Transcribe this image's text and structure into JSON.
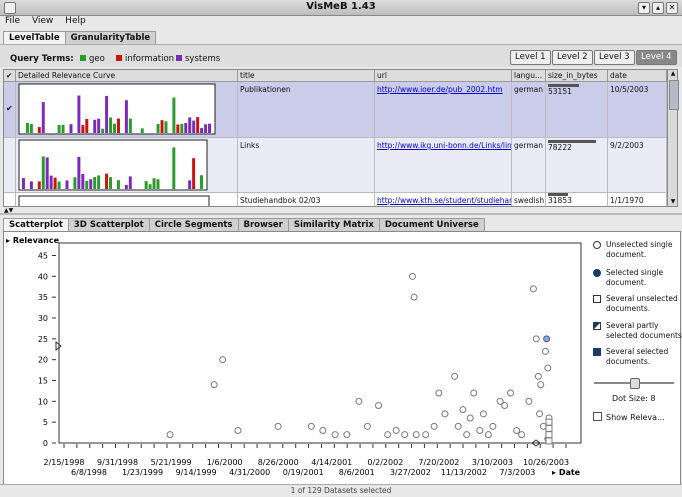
{
  "window": {
    "title": "VisMeB 1.43"
  },
  "menu": [
    "File",
    "View",
    "Help"
  ],
  "top_tabs": [
    "LevelTable",
    "GranularityTable"
  ],
  "query": {
    "label": "Query Terms:",
    "terms": [
      {
        "name": "geo",
        "color": "#2a9a2a"
      },
      {
        "name": "information",
        "color": "#cc1111"
      },
      {
        "name": "systems",
        "color": "#7a2ab8"
      }
    ]
  },
  "levels": [
    "Level 1",
    "Level 2",
    "Level 3",
    "Level 4"
  ],
  "active_level": "Level 4",
  "table": {
    "columns": [
      "Detailed Relevance Curve",
      "title",
      "url",
      "langu...",
      "size_in_bytes",
      "date"
    ],
    "rows": [
      {
        "title": "Publikationen",
        "url": "http://www.ioer.de/pub_2002.htm",
        "lang": "german",
        "size": "53151",
        "size_fraction": 0.55,
        "date": "10/5/2003"
      },
      {
        "title": "Links",
        "url": "http://www.ikg.uni-bonn.de/Links/lin",
        "lang": "german",
        "size": "78222",
        "size_fraction": 0.85,
        "date": "9/2/2003"
      },
      {
        "title": "Studiehandbok 02/03",
        "url": "http://www.kth.se/student/studiehand",
        "lang": "swedish",
        "size": "31853",
        "size_fraction": 0.35,
        "date": "1/1/1970"
      }
    ]
  },
  "bottom_tabs": [
    "Scatterplot",
    "3D Scatterplot",
    "Circle Segments",
    "Browser",
    "Similarity Matrix",
    "Document Universe"
  ],
  "chart_data": {
    "type": "scatter",
    "ylabel": "Relevance",
    "xlabel": "Date",
    "y_ticks": [
      "0",
      "5",
      "10",
      "15",
      "20",
      "25",
      "30",
      "35",
      "40",
      "45"
    ],
    "x_ticks_top": [
      "2/15/1998",
      "9/31/1998",
      "5/21/1999",
      "1/6/2000",
      "8/26/2000",
      "4/14/2001",
      "0/2/2002",
      "7/20/2002",
      "3/10/2003",
      "10/26/2003"
    ],
    "x_ticks_bottom": [
      "6/8/1998",
      "1/23/1999",
      "9/14/1999",
      "4/31/2000",
      "0/19/2001",
      "8/6/2001",
      "3/27/2002",
      "11/13/2002",
      "7/3/2003"
    ],
    "ylim": [
      0,
      48
    ],
    "points": [
      {
        "x": "1999-06-01",
        "y": 2
      },
      {
        "x": "1999-12-05",
        "y": 14
      },
      {
        "x": "2000-01-10",
        "y": 20
      },
      {
        "x": "2000-03-15",
        "y": 3
      },
      {
        "x": "2000-09-01",
        "y": 4
      },
      {
        "x": "2001-01-20",
        "y": 4
      },
      {
        "x": "2001-03-10",
        "y": 3
      },
      {
        "x": "2001-05-01",
        "y": 2
      },
      {
        "x": "2001-06-20",
        "y": 2
      },
      {
        "x": "2001-08-10",
        "y": 10
      },
      {
        "x": "2001-09-15",
        "y": 4
      },
      {
        "x": "2001-11-01",
        "y": 9
      },
      {
        "x": "2001-12-10",
        "y": 2
      },
      {
        "x": "2002-01-15",
        "y": 3
      },
      {
        "x": "2002-02-20",
        "y": 2
      },
      {
        "x": "2002-03-25",
        "y": 40
      },
      {
        "x": "2002-04-01",
        "y": 35
      },
      {
        "x": "2002-04-10",
        "y": 2
      },
      {
        "x": "2002-05-20",
        "y": 2
      },
      {
        "x": "2002-06-25",
        "y": 4
      },
      {
        "x": "2002-07-15",
        "y": 12
      },
      {
        "x": "2002-08-10",
        "y": 7
      },
      {
        "x": "2002-09-20",
        "y": 16
      },
      {
        "x": "2002-10-05",
        "y": 4
      },
      {
        "x": "2002-10-25",
        "y": 8
      },
      {
        "x": "2002-11-10",
        "y": 2
      },
      {
        "x": "2002-11-25",
        "y": 6
      },
      {
        "x": "2002-12-10",
        "y": 12
      },
      {
        "x": "2003-01-05",
        "y": 3
      },
      {
        "x": "2003-01-20",
        "y": 7
      },
      {
        "x": "2003-02-10",
        "y": 2
      },
      {
        "x": "2003-03-01",
        "y": 4
      },
      {
        "x": "2003-04-01",
        "y": 10
      },
      {
        "x": "2003-04-20",
        "y": 9
      },
      {
        "x": "2003-05-15",
        "y": 12
      },
      {
        "x": "2003-06-10",
        "y": 3
      },
      {
        "x": "2003-07-01",
        "y": 2
      },
      {
        "x": "2003-08-01",
        "y": 10
      },
      {
        "x": "2003-08-20",
        "y": 37
      },
      {
        "x": "2003-09-01",
        "y": 25
      },
      {
        "x": "2003-09-10",
        "y": 16
      },
      {
        "x": "2003-09-15",
        "y": 7
      },
      {
        "x": "2003-09-20",
        "y": 14
      },
      {
        "x": "2003-10-01",
        "y": 4
      },
      {
        "x": "2003-10-10",
        "y": 22
      },
      {
        "x": "2003-10-15",
        "y": 25,
        "selected": true
      },
      {
        "x": "2003-10-20",
        "y": 18
      },
      {
        "x": "2003-10-20",
        "y": 1
      },
      {
        "x": "2003-10-25",
        "y": 6
      }
    ]
  },
  "legend": [
    {
      "icon": "circle-empty",
      "label": "Unselected single document."
    },
    {
      "icon": "circle-filled",
      "label": "Selected single document."
    },
    {
      "icon": "square-empty",
      "label": "Several unselected documents."
    },
    {
      "icon": "square-partial",
      "label": "Several partly selected documents."
    },
    {
      "icon": "square-filled",
      "label": "Several selected documents."
    }
  ],
  "dot_size": {
    "label": "Dot Size: 8",
    "value_fraction": 0.5
  },
  "show_relevance": {
    "label": "Show Releva...",
    "checked": false
  },
  "status": "1 of 129 Datasets selected"
}
